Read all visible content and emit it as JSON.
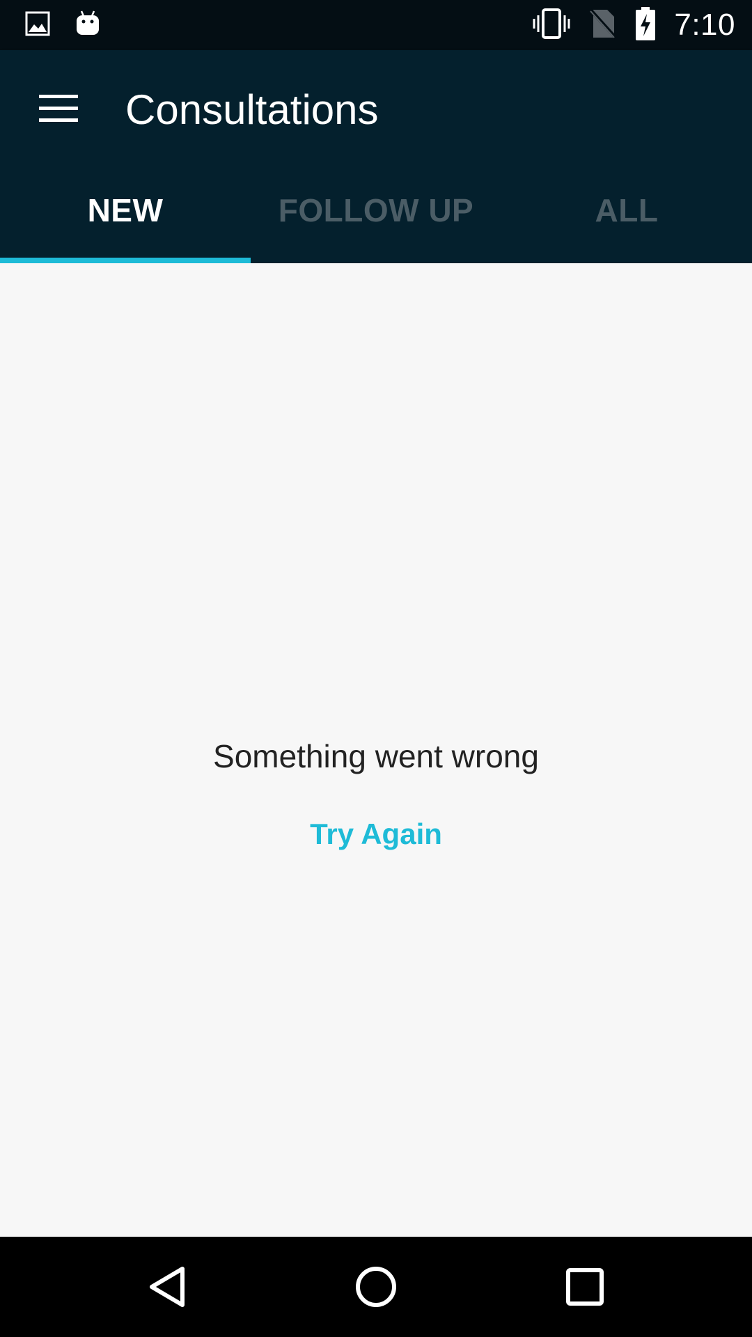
{
  "status_bar": {
    "time": "7:10",
    "icons": [
      "image-icon",
      "android-icon",
      "vibrate-icon",
      "no-sim-icon",
      "battery-charging-icon"
    ]
  },
  "app_bar": {
    "title": "Consultations",
    "menu_icon": "hamburger-menu-icon"
  },
  "tabs": [
    {
      "label": "NEW",
      "selected": true
    },
    {
      "label": "FOLLOW UP",
      "selected": false
    },
    {
      "label": "ALL",
      "selected": false
    }
  ],
  "content": {
    "error_message": "Something went wrong",
    "retry_label": "Try Again"
  },
  "nav_bar": {
    "icons": [
      "back-icon",
      "home-icon",
      "recents-icon"
    ]
  },
  "colors": {
    "status_bar": "#040E14",
    "app_bar": "#04202D",
    "accent": "#1EBBD7",
    "inactive_tab": "#4B5D66",
    "background": "#F7F7F7"
  }
}
